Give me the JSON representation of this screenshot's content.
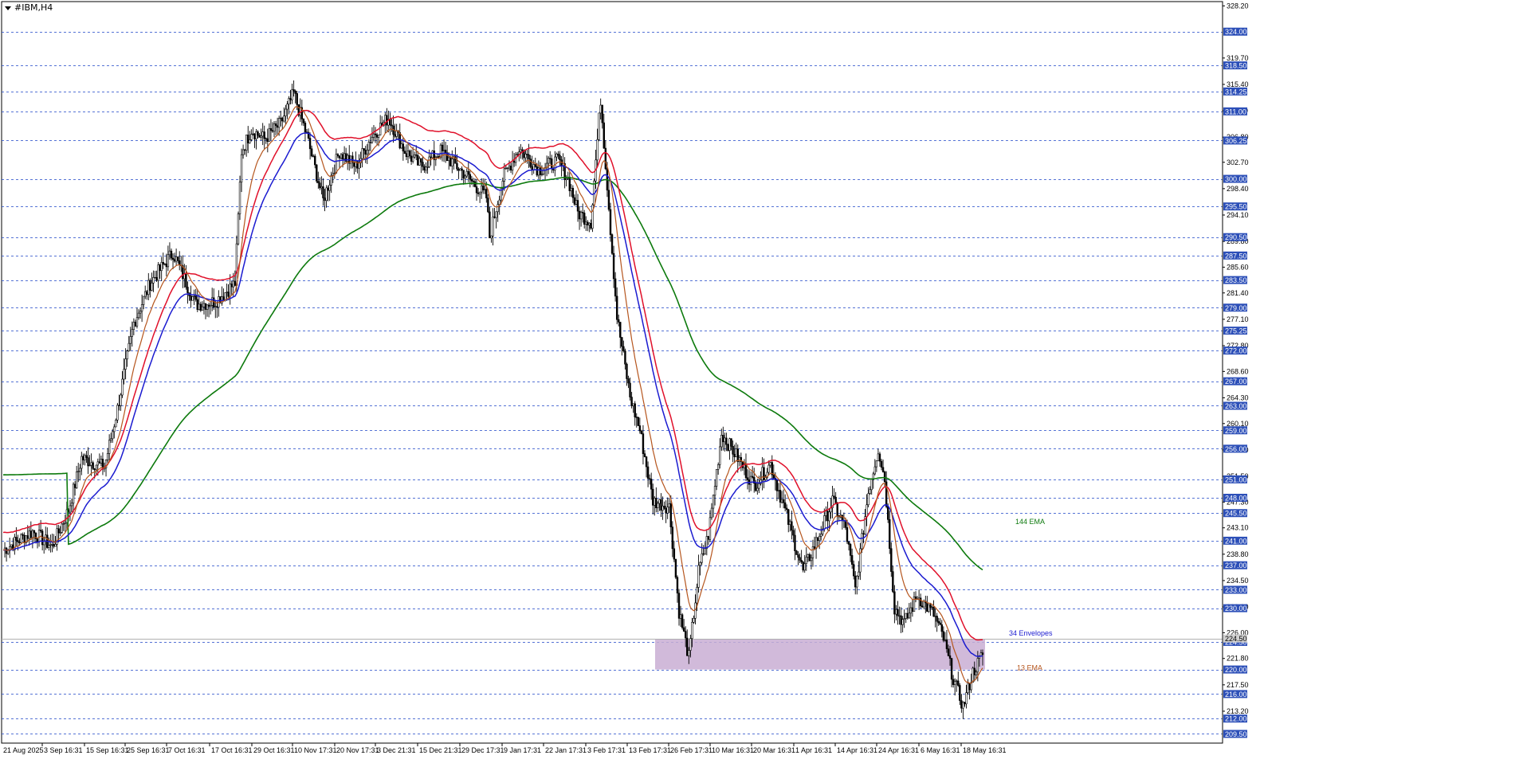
{
  "window": {
    "symbol_title": "#IBM,H4"
  },
  "chart_data": {
    "type": "candlestick",
    "symbol": "#IBM",
    "timeframe": "H4",
    "ylim": [
      208.0,
      328.9
    ],
    "x_tick_labels": [
      "21 Aug 2025",
      "3 Sep 16:31",
      "15 Sep 16:31",
      "25 Sep 16:31",
      "7 Oct 16:31",
      "17 Oct 16:31",
      "29 Oct 16:31",
      "10 Nov 17:31",
      "20 Nov 17:31",
      "3 Dec 21:31",
      "15 Dec 21:31",
      "29 Dec 17:31",
      "9 Jan 17:31",
      "22 Jan 17:31",
      "3 Feb 17:31",
      "13 Feb 17:31",
      "26 Feb 17:31",
      "10 Mar 16:31",
      "20 Mar 16:31",
      "1 Apr 16:31",
      "14 Apr 16:31",
      "24 Apr 16:31",
      "6 May 16:31",
      "18 May 16:31"
    ],
    "price_scale_labels": [
      328.2,
      319.7,
      315.4,
      311.1,
      306.8,
      302.7,
      298.4,
      294.1,
      289.8,
      285.6,
      281.4,
      277.1,
      272.8,
      268.6,
      264.3,
      260.1,
      255.8,
      251.5,
      247.3,
      243.1,
      238.8,
      234.5,
      230.2,
      226.0,
      221.8,
      217.5,
      213.2
    ],
    "horizontal_levels": [
      324.0,
      318.5,
      314.25,
      311.0,
      306.25,
      300.0,
      295.5,
      290.5,
      287.5,
      283.5,
      279.0,
      275.25,
      272.0,
      267.0,
      263.0,
      259.0,
      256.0,
      251.0,
      248.0,
      245.5,
      241.0,
      237.0,
      233.0,
      230.0,
      224.5,
      220.0,
      216.0,
      212.0,
      209.5
    ],
    "current_price": 224.5,
    "support_zone": {
      "from": 220.0,
      "to": 224.9,
      "color": "#c9aed3"
    },
    "close_path": [
      [
        0,
        239.5
      ],
      [
        18,
        242.5
      ],
      [
        30,
        240.0
      ],
      [
        40,
        246.0
      ],
      [
        48,
        254.5
      ],
      [
        62,
        253.0
      ],
      [
        70,
        262.5
      ],
      [
        80,
        276.5
      ],
      [
        90,
        283.0
      ],
      [
        104,
        288.0
      ],
      [
        118,
        279.5
      ],
      [
        130,
        280.0
      ],
      [
        142,
        283.0
      ],
      [
        146,
        304.5
      ],
      [
        152,
        308.0
      ],
      [
        160,
        306.5
      ],
      [
        170,
        309.0
      ],
      [
        178,
        314.0
      ],
      [
        186,
        307.0
      ],
      [
        196,
        296.5
      ],
      [
        206,
        304.5
      ],
      [
        216,
        302.0
      ],
      [
        226,
        307.0
      ],
      [
        236,
        310.0
      ],
      [
        246,
        304.5
      ],
      [
        256,
        302.0
      ],
      [
        268,
        304.5
      ],
      [
        282,
        301.0
      ],
      [
        296,
        297.0
      ],
      [
        298,
        290.5
      ],
      [
        306,
        300.0
      ],
      [
        316,
        305.0
      ],
      [
        328,
        301.5
      ],
      [
        340,
        303.0
      ],
      [
        346,
        300.0
      ],
      [
        352,
        294.5
      ],
      [
        360,
        293.0
      ],
      [
        366,
        313.0
      ],
      [
        370,
        299.0
      ],
      [
        376,
        277.5
      ],
      [
        384,
        264.5
      ],
      [
        390,
        259.0
      ],
      [
        398,
        247.5
      ],
      [
        408,
        246.5
      ],
      [
        414,
        229.5
      ],
      [
        420,
        222.0
      ],
      [
        426,
        236.0
      ],
      [
        432,
        242.0
      ],
      [
        440,
        258.5
      ],
      [
        450,
        254.5
      ],
      [
        460,
        250.0
      ],
      [
        470,
        253.5
      ],
      [
        480,
        245.0
      ],
      [
        490,
        236.0
      ],
      [
        500,
        242.0
      ],
      [
        508,
        247.5
      ],
      [
        516,
        243.0
      ],
      [
        522,
        233.0
      ],
      [
        530,
        249.0
      ],
      [
        536,
        256.0
      ],
      [
        540,
        251.0
      ],
      [
        546,
        230.0
      ],
      [
        552,
        227.5
      ],
      [
        560,
        232.0
      ],
      [
        570,
        229.0
      ],
      [
        576,
        225.0
      ],
      [
        582,
        218.5
      ],
      [
        588,
        214.0
      ],
      [
        594,
        219.5
      ],
      [
        600,
        222.5
      ],
      [
        604,
        224.8
      ]
    ],
    "indicators": [
      {
        "name": "13 EMA",
        "label": "13 EMA",
        "color": "#b5551d",
        "type": "EMA",
        "period": 13
      },
      {
        "name": "34 Envelopes",
        "label": "34 Envelopes",
        "color": "#1b1bd0",
        "type": "Envelope",
        "period": 34
      },
      {
        "name": "34 Envelopes upper",
        "color": "#e0102a",
        "type": "Envelope",
        "period": 34
      },
      {
        "name": "144 EMA",
        "label": "144 EMA",
        "color": "#0d7a0d",
        "type": "EMA",
        "period": 144
      }
    ],
    "grid": true,
    "colors": {
      "up": "#000000",
      "down": "#000000",
      "grid": "#1e45c8",
      "background": "#ffffff",
      "level_tag_bg": "#2c4fb8"
    }
  }
}
